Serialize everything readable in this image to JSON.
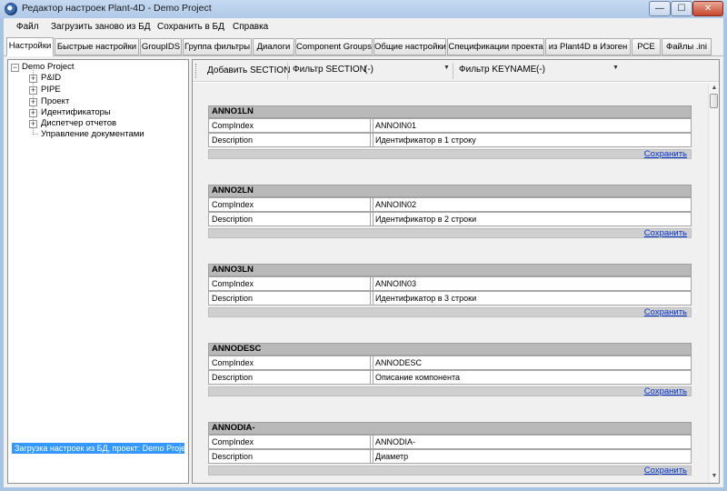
{
  "window": {
    "title": "Редактор настроек Plant-4D - Demo Project",
    "min_glyph": "—",
    "max_glyph": "☐",
    "close_glyph": "✕"
  },
  "menu": {
    "items": [
      "Файл",
      "Загрузить заново из БД",
      "Сохранить в БД",
      "Справка"
    ]
  },
  "tabs": [
    {
      "label": "Настройки",
      "active": true
    },
    {
      "label": "Быстрые настройки",
      "active": false
    },
    {
      "label": "GroupIDS",
      "active": false
    },
    {
      "label": "Группа фильтры",
      "active": false
    },
    {
      "label": "Диалоги",
      "active": false
    },
    {
      "label": "Component Groups",
      "active": false
    },
    {
      "label": "Общие настройки",
      "active": false
    },
    {
      "label": "Спецификации проекта",
      "active": false
    },
    {
      "label": "из Plant4D в Изоген",
      "active": false
    },
    {
      "label": "PCE",
      "active": false
    },
    {
      "label": "Файлы .ini",
      "active": false
    }
  ],
  "tree": {
    "root": "Demo Project",
    "children": [
      "P&ID",
      "PIPE",
      "Проект",
      "Идентификаторы",
      "Диспетчер отчетов",
      "Управление документами"
    ]
  },
  "status": "Загрузка настроек из БД, проект: Demo Project",
  "toolbar": {
    "add_section": "Добавить SECTION",
    "filter_section_label": "Фильтр SECTION",
    "filter_section_value": "(-)",
    "filter_keyname_label": "Фильтр KEYNAME",
    "filter_keyname_value": "(-)"
  },
  "sections": [
    {
      "name": "ANNO1LN",
      "rows": [
        {
          "key": "CompIndex",
          "value": "ANNOIN01"
        },
        {
          "key": "Description",
          "value": "Идентификатор в 1 строку"
        }
      ],
      "save": "Сохранить"
    },
    {
      "name": "ANNO2LN",
      "rows": [
        {
          "key": "CompIndex",
          "value": "ANNOIN02"
        },
        {
          "key": "Description",
          "value": "Идентификатор в 2 строки"
        }
      ],
      "save": "Сохранить"
    },
    {
      "name": "ANNO3LN",
      "rows": [
        {
          "key": "CompIndex",
          "value": "ANNOIN03"
        },
        {
          "key": "Description",
          "value": "Идентификатор в 3 строки"
        }
      ],
      "save": "Сохранить"
    },
    {
      "name": "ANNODESC",
      "rows": [
        {
          "key": "CompIndex",
          "value": "ANNODESC"
        },
        {
          "key": "Description",
          "value": "Описание компонента"
        }
      ],
      "save": "Сохранить"
    },
    {
      "name": "ANNODIA-",
      "rows": [
        {
          "key": "CompIndex",
          "value": "ANNODIA-"
        },
        {
          "key": "Description",
          "value": "Диаметр"
        }
      ],
      "save": "Сохранить"
    }
  ]
}
